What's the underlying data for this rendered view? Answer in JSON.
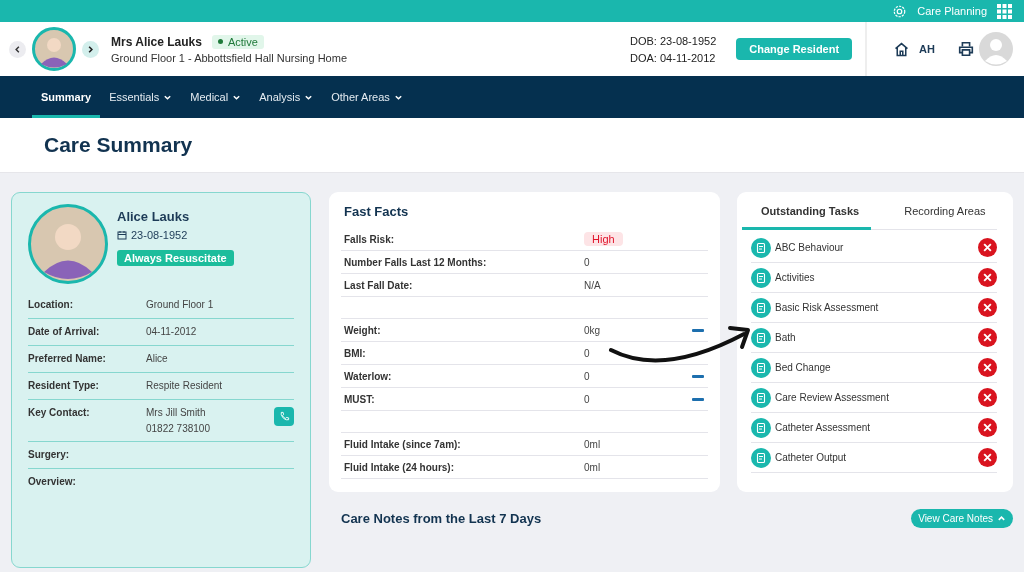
{
  "top_bar": {
    "app_name": "Care Planning"
  },
  "resident_header": {
    "name": "Mrs Alice Lauks",
    "status": "Active",
    "location": "Ground Floor 1 - Abbottsfield Hall Nursing Home",
    "dob": "DOB: 23-08-1952",
    "doa": "DOA: 04-11-2012",
    "change_button": "Change Resident",
    "user_initials": "AH"
  },
  "nav": [
    {
      "label": "Summary",
      "selected": true,
      "has_menu": false
    },
    {
      "label": "Essentials",
      "selected": false,
      "has_menu": true
    },
    {
      "label": "Medical",
      "selected": false,
      "has_menu": true
    },
    {
      "label": "Analysis",
      "selected": false,
      "has_menu": true
    },
    {
      "label": "Other Areas",
      "selected": false,
      "has_menu": true
    }
  ],
  "page_title": "Care Summary",
  "profile": {
    "name": "Alice Lauks",
    "dob": "23-08-1952",
    "resus_badge": "Always Resuscitate",
    "fields": [
      {
        "label": "Location:",
        "value": "Ground Floor 1"
      },
      {
        "label": "Date of Arrival:",
        "value": "04-11-2012"
      },
      {
        "label": "Preferred Name:",
        "value": "Alice"
      },
      {
        "label": "Resident Type:",
        "value": "Respite Resident"
      },
      {
        "label": "Key Contact:",
        "value": "Mrs Jill Smith",
        "phone": "01822 738100"
      },
      {
        "label": "Surgery:"
      },
      {
        "label": "Overview:"
      }
    ]
  },
  "fast_facts": {
    "title": "Fast Facts",
    "rows": [
      {
        "kind": "badge",
        "label": "Falls Risk:",
        "value": "High",
        "trend": false
      },
      {
        "kind": "text",
        "label": "Number Falls Last 12 Months:",
        "value": "0",
        "trend": false
      },
      {
        "kind": "text",
        "label": "Last Fall Date:",
        "value": "N/A",
        "trend": false
      },
      {
        "kind": "spacer"
      },
      {
        "kind": "text",
        "label": "Weight:",
        "value": "0kg",
        "trend": true
      },
      {
        "kind": "text",
        "label": "BMI:",
        "value": "0",
        "trend": false
      },
      {
        "kind": "text",
        "label": "Waterlow:",
        "value": "0",
        "trend": true
      },
      {
        "kind": "text",
        "label": "MUST:",
        "value": "0",
        "trend": true
      },
      {
        "kind": "spacer"
      },
      {
        "kind": "text",
        "label": "Fluid Intake (since 7am):",
        "value": "0ml",
        "trend": false
      },
      {
        "kind": "text",
        "label": "Fluid Intake (24 hours):",
        "value": "0ml",
        "trend": false
      }
    ]
  },
  "task_panel": {
    "tabs": [
      {
        "label": "Outstanding Tasks",
        "selected": true
      },
      {
        "label": "Recording Areas",
        "selected": false
      }
    ],
    "tasks": [
      "ABC Behaviour",
      "Activities",
      "Basic Risk Assessment",
      "Bath",
      "Bed Change",
      "Care Review Assessment",
      "Catheter Assessment",
      "Catheter Output"
    ]
  },
  "care_notes": {
    "title": "Care Notes from the Last 7 Days",
    "button": "View Care Notes"
  }
}
